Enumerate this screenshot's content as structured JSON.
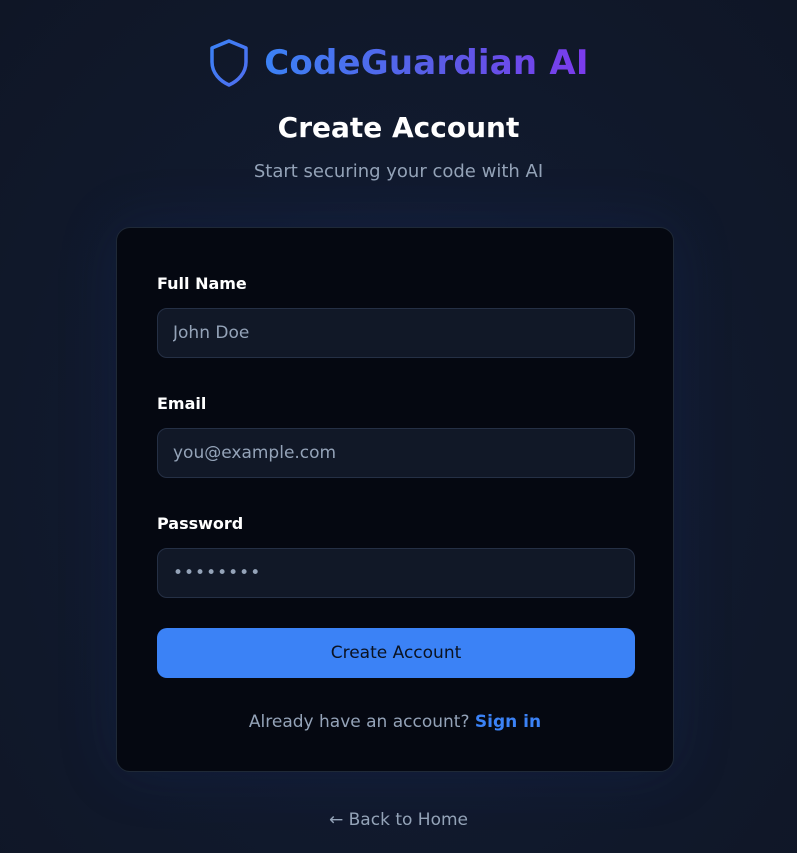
{
  "brand": {
    "name": "CodeGuardian AI",
    "icon": "shield-icon",
    "gradient": [
      "#3b82f6",
      "#7c3aed"
    ]
  },
  "header": {
    "title": "Create Account",
    "subtitle": "Start securing your code with AI"
  },
  "form": {
    "full_name": {
      "label": "Full Name",
      "placeholder": "John Doe",
      "value": ""
    },
    "email": {
      "label": "Email",
      "placeholder": "you@example.com",
      "value": ""
    },
    "password": {
      "label": "Password",
      "value": "••••••••"
    },
    "submit_label": "Create Account"
  },
  "signin": {
    "prompt": "Already have an account?",
    "link_label": "Sign in"
  },
  "footer": {
    "back_label": "← Back to Home"
  },
  "colors": {
    "background": "#111827",
    "card": "#050811",
    "input": "#111827",
    "accent": "#3b82f6",
    "muted_text": "#94a3b8"
  }
}
